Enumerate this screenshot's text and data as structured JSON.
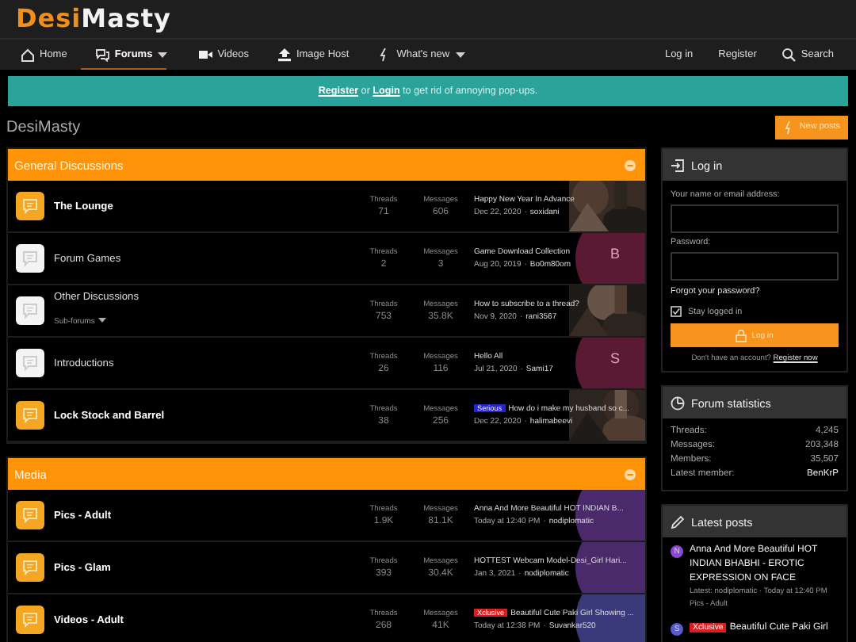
{
  "header": {
    "logo": [
      "Desi",
      "Masty"
    ]
  },
  "nav": {
    "items": [
      {
        "label": "Home",
        "selected": false,
        "dropdown": false
      },
      {
        "label": "Forums",
        "selected": true,
        "dropdown": true
      },
      {
        "label": "Videos",
        "selected": false,
        "dropdown": false
      },
      {
        "label": "Image Host",
        "selected": false,
        "dropdown": false
      },
      {
        "label": "What's new",
        "selected": false,
        "dropdown": true
      }
    ],
    "actions": [
      {
        "label": "Log in"
      },
      {
        "label": "Register"
      },
      {
        "label": "Search"
      }
    ]
  },
  "notice": {
    "register": "Register",
    "or": "or",
    "login": "Login",
    "text": "to get rid of annoying pop-ups."
  },
  "page": {
    "title": "DesiMasty",
    "new_posts": "New posts"
  },
  "categories": [
    {
      "title": "General Discussions",
      "nodes": [
        {
          "title": "The Lounge",
          "unread": true,
          "threads_label": "Threads",
          "threads": "71",
          "messages_label": "Messages",
          "messages": "606",
          "latest": {
            "title": "Happy New Year In Advance",
            "date": "Dec 22, 2020",
            "sep": "·",
            "user": "soxidani"
          }
        },
        {
          "title": "Forum Games",
          "unread": false,
          "threads_label": "Threads",
          "threads": "2",
          "messages_label": "Messages",
          "messages": "3",
          "latest": {
            "title": "Game Download Collection",
            "date": "Aug 20, 2019",
            "sep": "·",
            "user": "Bo0m80om",
            "avatar": {
              "kind": "letter",
              "letter": "B",
              "color": "#5a1a33"
            }
          }
        },
        {
          "title": "Other Discussions",
          "unread": false,
          "sub_forums": "Sub-forums",
          "threads_label": "Threads",
          "threads": "753",
          "messages_label": "Messages",
          "messages": "35.8K",
          "latest": {
            "title": "How to subscribe to a thread?",
            "date": "Nov 9, 2020",
            "sep": "·",
            "user": "rani3567"
          }
        },
        {
          "title": "Introductions",
          "unread": false,
          "threads_label": "Threads",
          "threads": "26",
          "messages_label": "Messages",
          "messages": "116",
          "latest": {
            "title": "Hello All",
            "date": "Jul 21, 2020",
            "sep": "·",
            "user": "Sami17",
            "avatar": {
              "kind": "letter",
              "letter": "S",
              "color": "#5a1a33"
            }
          }
        },
        {
          "title": "Lock Stock and Barrel",
          "unread": true,
          "threads_label": "Threads",
          "threads": "38",
          "messages_label": "Messages",
          "messages": "256",
          "latest": {
            "prefix": {
              "label": "Serious",
              "color": "#2424c8"
            },
            "title": "How do i make my husband so c...",
            "date": "Dec 22, 2020",
            "sep": "·",
            "user": "halimabeevi"
          }
        }
      ]
    },
    {
      "title": "Media",
      "nodes": [
        {
          "title": "Pics - Adult",
          "unread": true,
          "threads_label": "Threads",
          "threads": "1.9K",
          "messages_label": "Messages",
          "messages": "81.1K",
          "latest": {
            "title": "Anna And More Beautiful HOT INDIAN B...",
            "date": "Today at 12:40 PM",
            "sep": "·",
            "user": "nodiplomatic",
            "avatar": {
              "kind": "letter",
              "color": "#4a2a6a"
            }
          }
        },
        {
          "title": "Pics - Glam",
          "unread": true,
          "threads_label": "Threads",
          "threads": "393",
          "messages_label": "Messages",
          "messages": "30.4K",
          "latest": {
            "title": "HOTTEST Webcam Model-Desi_Girl Hari...",
            "date": "Jan 3, 2021",
            "sep": "·",
            "user": "nodiplomatic",
            "avatar": {
              "kind": "letter",
              "color": "#4a2a6a"
            }
          }
        },
        {
          "title": "Videos - Adult",
          "unread": true,
          "threads_label": "Threads",
          "threads": "268",
          "messages_label": "Messages",
          "messages": "41K",
          "latest": {
            "prefix": {
              "label": "Xclusive",
              "color": "#d42020"
            },
            "title": "Beautiful Cute Paki Girl Showing ...",
            "date": "Today at 12:38 PM",
            "sep": "·",
            "user": "Suvankar520",
            "avatar": {
              "kind": "letter",
              "color": "#3a3a7a"
            }
          }
        }
      ]
    }
  ],
  "login": {
    "title": "Log in",
    "name_label": "Your name or email address:",
    "password_label": "Password:",
    "forgot": "Forgot your password?",
    "stay": {
      "label": "Stay logged in",
      "checked": true
    },
    "button": "Log in",
    "no_account": "Don't have an account?",
    "register": "Register now"
  },
  "stats": {
    "title": "Forum statistics",
    "rows": [
      {
        "label": "Threads:",
        "value": "4,245"
      },
      {
        "label": "Messages:",
        "value": "203,348"
      },
      {
        "label": "Members:",
        "value": "35,507"
      },
      {
        "label": "Latest member:",
        "value": "BenKrP"
      }
    ]
  },
  "latest_posts": {
    "title": "Latest posts",
    "items": [
      {
        "avatar": {
          "letter": "N",
          "color": "#8a4ad0"
        },
        "title": "Anna And More Beautiful HOT INDIAN BHABHI - EROTIC EXPRESSION ON FACE",
        "meta": "Latest: nodiplomatic · Today at 12:40 PM",
        "forum": "Pics - Adult"
      },
      {
        "avatar": {
          "letter": "S",
          "color": "#5a5ad0"
        },
        "prefix": {
          "label": "Xclusive",
          "color": "#d42020"
        },
        "title": "Beautiful Cute Paki Girl"
      }
    ]
  }
}
